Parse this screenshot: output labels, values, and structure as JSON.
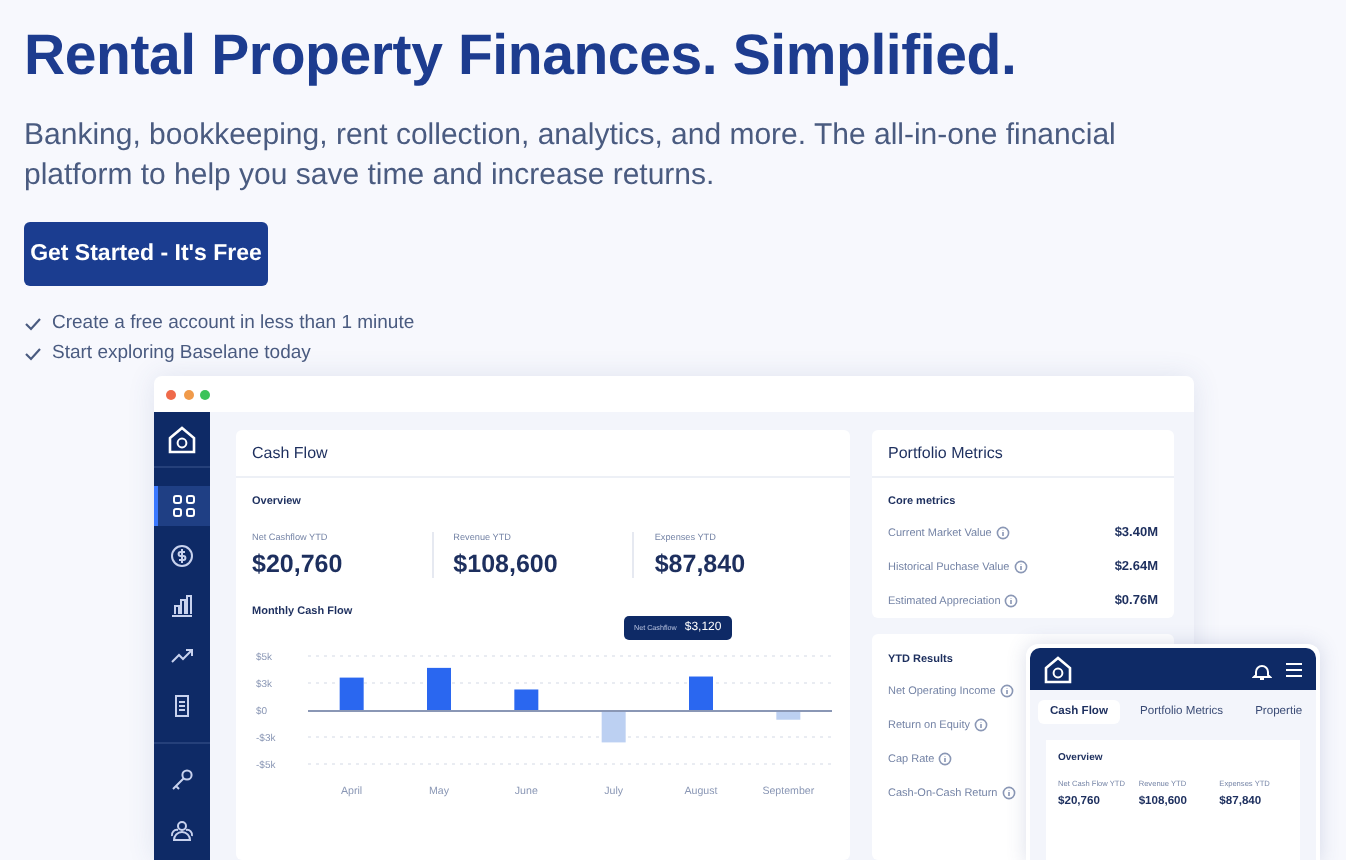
{
  "hero": {
    "title": "Rental Property Finances. Simplified.",
    "subtitle": "Banking, bookkeeping, rent collection, analytics, and more. The all-in-one financial platform to help you save time and increase returns.",
    "cta": "Get Started - It's Free",
    "checks": [
      "Create a free account in less than 1 minute",
      "Start exploring Baselane today"
    ]
  },
  "sidebar": {
    "items": [
      {
        "selected": true
      },
      {
        "selected": false
      },
      {
        "selected": false
      },
      {
        "selected": false
      },
      {
        "selected": false
      },
      {
        "selected": false
      },
      {
        "selected": false
      }
    ]
  },
  "cash_flow": {
    "title": "Cash Flow",
    "overview_label": "Overview",
    "stats": [
      {
        "label": "Net Cashflow YTD",
        "value": "$20,760"
      },
      {
        "label": "Revenue YTD",
        "value": "$108,600"
      },
      {
        "label": "Expenses YTD",
        "value": "$87,840"
      }
    ],
    "chart_title": "Monthly Cash Flow",
    "chart_data": {
      "type": "bar",
      "categories": [
        "April",
        "May",
        "June",
        "July",
        "August",
        "September"
      ],
      "values": [
        3000,
        3900,
        1900,
        -3000,
        3100,
        -900
      ],
      "ylim": [
        -5000,
        5000
      ],
      "yticks": [
        {
          "value": 5000,
          "label": "$5k"
        },
        {
          "value": 2500,
          "label": "$3k"
        },
        {
          "value": 0,
          "label": "$0"
        },
        {
          "value": -2500,
          "label": "-$3k"
        },
        {
          "value": -5000,
          "label": "-$5k"
        }
      ]
    },
    "tooltip": {
      "label": "Net Cashflow",
      "value": "$3,120"
    }
  },
  "portfolio": {
    "title": "Portfolio Metrics",
    "core_label": "Core metrics",
    "core": [
      {
        "label": "Current Market Value",
        "value": "$3.40M"
      },
      {
        "label": "Historical Puchase Value",
        "value": "$2.64M"
      },
      {
        "label": "Estimated Appreciation",
        "value": "$0.76M"
      }
    ],
    "ytd_label": "YTD Results",
    "ytd": [
      "Net Operating Income",
      "Return on Equity",
      "Cap Rate",
      "Cash-On-Cash Return"
    ]
  },
  "mobile": {
    "tabs": [
      {
        "label": "Cash Flow",
        "selected": true
      },
      {
        "label": "Portfolio Metrics",
        "selected": false
      },
      {
        "label": "Propertie",
        "selected": false
      }
    ],
    "overview_label": "Overview",
    "stats": [
      {
        "label": "Net Cash Flow YTD",
        "value": "$20,760"
      },
      {
        "label": "Revenue YTD",
        "value": "$108,600"
      },
      {
        "label": "Expenses YTD",
        "value": "$87,840"
      }
    ]
  }
}
